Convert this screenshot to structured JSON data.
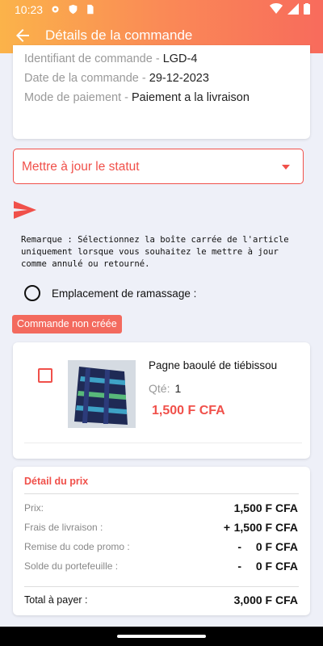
{
  "status_bar": {
    "time": "10:23"
  },
  "header": {
    "title": "Détails de la commande"
  },
  "order_info": {
    "id_label": "Identifiant de commande - ",
    "id_value": "LGD-4",
    "date_label": "Date de la commande - ",
    "date_value": "29-12-2023",
    "payment_label": "Mode de paiement - ",
    "payment_value": "Paiement a la livraison"
  },
  "status_dropdown": {
    "label": "Mettre à jour le statut"
  },
  "remark": "Remarque : Sélectionnez la boîte carrée de l'article uniquement lorsque vous souhaitez le mettre à jour comme annulé ou retourné.",
  "pickup": {
    "label": "Emplacement de ramassage :"
  },
  "badge": "Commande non créée",
  "item": {
    "name": "Pagne baoulé de tiébissou",
    "qty_label": "Qté:",
    "qty_value": "1",
    "price": "1,500 F CFA"
  },
  "price_detail": {
    "title": "Détail du prix",
    "rows": [
      {
        "label": "Prix:",
        "sign": "",
        "value": "1,500 F CFA"
      },
      {
        "label": "Frais de livraison :",
        "sign": "+",
        "value": "1,500 F CFA"
      },
      {
        "label": "Remise du code promo :",
        "sign": "-",
        "value": "0 F CFA"
      },
      {
        "label": "Solde du portefeuille :",
        "sign": "-",
        "value": "0 F CFA"
      }
    ],
    "total_label": "Total à payer :",
    "total_value": "3,000 F CFA"
  },
  "colors": {
    "accent": "#f0504a",
    "header_start": "#fbb34a",
    "header_end": "#f86b5c",
    "badge": "#f36a5e"
  }
}
